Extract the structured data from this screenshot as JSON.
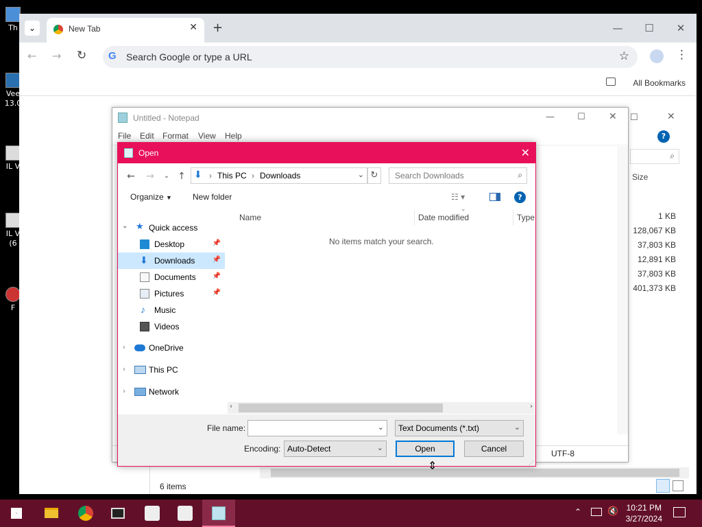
{
  "desktop": {
    "icons": [
      {
        "label": "Th"
      },
      {
        "label": "Vee"
      },
      {
        "label": "13.0"
      },
      {
        "label": "IL V"
      },
      {
        "label": "IL V"
      },
      {
        "label": "(6"
      },
      {
        "label": "F"
      }
    ]
  },
  "chrome": {
    "tab_title": "New Tab",
    "omnibox_placeholder": "Search Google or type a URL",
    "bookmarks_label": "All Bookmarks"
  },
  "explorer_bg": {
    "size_header": "Size",
    "sizes": [
      "1 KB",
      "128,067 KB",
      "37,803 KB",
      "12,891 KB",
      "37,803 KB",
      "401,373 KB"
    ],
    "item_count": "6 items"
  },
  "notepad": {
    "title": "Untitled - Notepad",
    "menu": [
      "File",
      "Edit",
      "Format",
      "View",
      "Help"
    ],
    "encoding_status": "UTF-8"
  },
  "dialog": {
    "title": "Open",
    "breadcrumb": [
      "This PC",
      "Downloads"
    ],
    "search_placeholder": "Search Downloads",
    "organize": "Organize",
    "new_folder": "New folder",
    "nav": {
      "quick_access": "Quick access",
      "items": [
        "Desktop",
        "Downloads",
        "Documents",
        "Pictures",
        "Music",
        "Videos"
      ],
      "onedrive": "OneDrive",
      "this_pc": "This PC",
      "network": "Network"
    },
    "columns": {
      "name": "Name",
      "date": "Date modified",
      "type": "Type"
    },
    "empty_message": "No items match your search.",
    "file_name_label": "File name:",
    "file_name_value": "",
    "file_type": "Text Documents (*.txt)",
    "encoding_label": "Encoding:",
    "encoding_value": "Auto-Detect",
    "open_label": "Open",
    "cancel_label": "Cancel"
  },
  "taskbar": {
    "time": "10:21 PM",
    "date": "3/27/2024"
  },
  "colors": {
    "dialog_accent": "#e8105a",
    "taskbar": "#62102a",
    "selection": "#cce8ff",
    "primary_button_border": "#0078d7"
  }
}
